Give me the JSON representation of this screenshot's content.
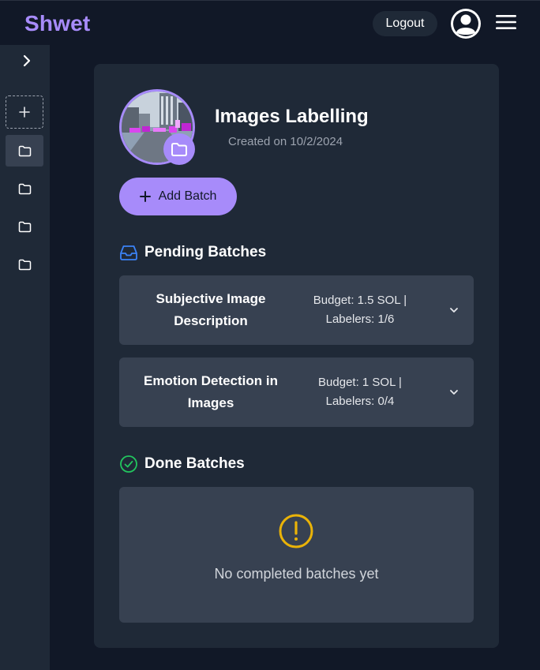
{
  "header": {
    "brand": "Shwet",
    "logout_label": "Logout",
    "avatar_icon": "user-circle-icon",
    "menu_icon": "hamburger-menu-icon"
  },
  "sidebar": {
    "toggle_icon": "chevron-right-icon",
    "add_icon": "plus-icon",
    "folders": [
      {
        "icon": "folder-icon",
        "active": true
      },
      {
        "icon": "folder-icon",
        "active": false
      },
      {
        "icon": "folder-icon",
        "active": false
      },
      {
        "icon": "folder-icon",
        "active": false
      }
    ]
  },
  "project": {
    "title": "Images Labelling",
    "created": "Created on 10/2/2024",
    "badge_icon": "folder-icon"
  },
  "add_batch_label": "Add Batch",
  "pending": {
    "title": "Pending Batches",
    "icon": "inbox-icon",
    "batches": [
      {
        "name": "Subjective Image Description",
        "budget": "Budget: 1.5 SOL |",
        "labelers": "Labelers: 1/6"
      },
      {
        "name": "Emotion Detection in Images",
        "budget": "Budget: 1 SOL |",
        "labelers": "Labelers: 0/4"
      }
    ]
  },
  "done": {
    "title": "Done Batches",
    "icon": "check-circle-icon",
    "empty_text": "No completed batches yet",
    "empty_icon": "exclamation-circle-icon"
  },
  "colors": {
    "accent": "#a78bfa",
    "background": "#111827",
    "panel": "#1f2937",
    "card": "#374151",
    "pending_icon": "#3b82f6",
    "done_icon": "#22c55e",
    "warning_icon": "#eab308"
  }
}
